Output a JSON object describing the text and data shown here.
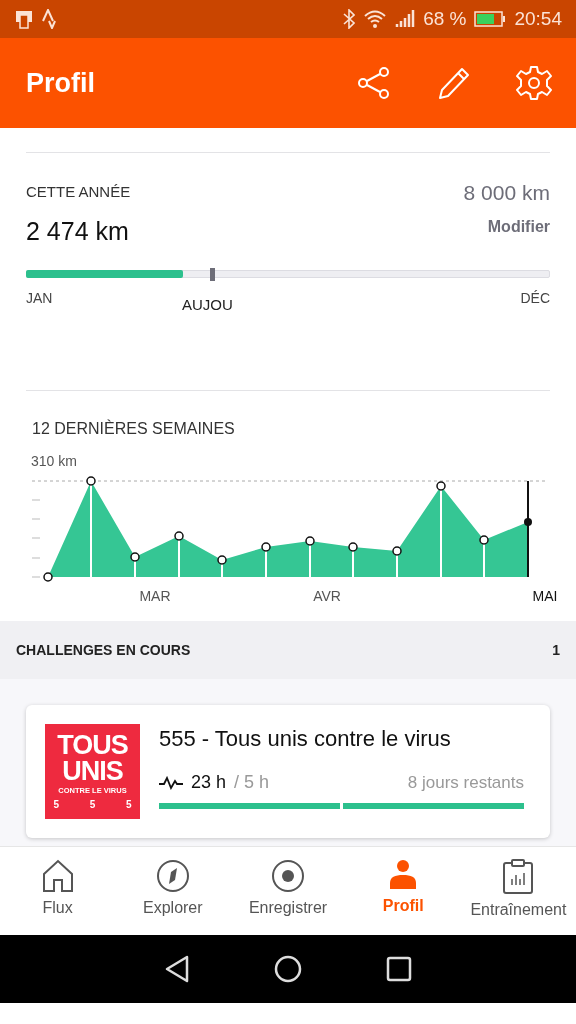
{
  "status_bar": {
    "battery": "68 %",
    "time": "20:54"
  },
  "header": {
    "title": "Profil"
  },
  "year": {
    "title": "CETTE ANNÉE",
    "distance": "2 474 km",
    "goal": "8 000 km",
    "edit": "Modifier",
    "level": 0.3,
    "today": {
      "label": "AUJOU",
      "level": 0.355
    },
    "start": "JAN",
    "end": "DÉC"
  },
  "weeks": {
    "title": "12 DERNIÈRES SEMAINES",
    "max_label": "310 km",
    "months": [
      "MAR",
      "AVR",
      "MAI"
    ]
  },
  "challenges": {
    "title": "CHALLENGES EN COURS",
    "count": "1",
    "items": [
      {
        "logo": {
          "line_1": "TOUS",
          "line_2": "UNIS",
          "line_3": "CONTRE LE VIRUS",
          "digits": [
            "5",
            "5",
            "5"
          ]
        },
        "name": "555 - Tous unis contre le virus",
        "done": "23 h",
        "target": "/ 5 h",
        "remaining": "8 jours restants",
        "segments": [
          {
            "level": 1
          },
          {
            "level": 1
          }
        ]
      }
    ]
  },
  "nav": [
    {
      "label": "Flux",
      "kind": "home",
      "selected": false
    },
    {
      "label": "Explorer",
      "kind": "compass",
      "selected": false
    },
    {
      "label": "Enregistrer",
      "kind": "record",
      "selected": false
    },
    {
      "label": "Profil",
      "kind": "person",
      "selected": true
    },
    {
      "label": "Entraînement",
      "kind": "clipboard",
      "selected": false
    }
  ]
}
